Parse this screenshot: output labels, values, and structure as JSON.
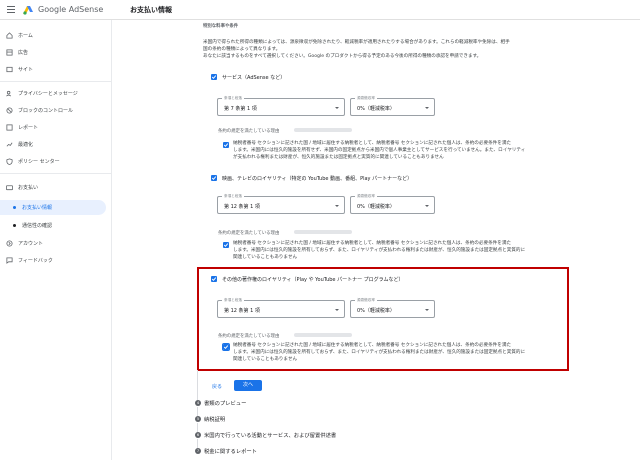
{
  "topbar": {
    "brand": "Google AdSense",
    "title": "お支払い情報"
  },
  "sidebar": {
    "items": [
      {
        "label": "ホーム",
        "icon": "home-icon"
      },
      {
        "label": "広告",
        "icon": "ads-icon"
      },
      {
        "label": "サイト",
        "icon": "sites-icon"
      },
      {
        "label": "プライバシーとメッセージ",
        "icon": "privacy-icon"
      },
      {
        "label": "ブロックのコントロール",
        "icon": "block-icon"
      },
      {
        "label": "レポート",
        "icon": "reports-icon"
      },
      {
        "label": "最適化",
        "icon": "optimize-icon"
      },
      {
        "label": "ポリシー センター",
        "icon": "policy-icon"
      },
      {
        "label": "お支払い",
        "icon": "payments-icon"
      },
      {
        "label": "お支払い情報",
        "icon": "dot"
      },
      {
        "label": "通信性の確認",
        "icon": "dot"
      },
      {
        "label": "アカウント",
        "icon": "account-icon"
      },
      {
        "label": "フィードバック",
        "icon": "feedback-icon"
      }
    ]
  },
  "form": {
    "section_title": "特別な料率や条件",
    "intro_line1": "米国内で得られた所得の種類によっては、源泉徴収が免除されたり、軽減税率が適用されたりする場合があります。これらの軽減税率や免除は、相手",
    "intro_line2": "国の条約の種類によって異なります。",
    "intro_line3": "あなたに該当するものをすべて選択してください。Google のプロダクトから得る予定のある今後の所得の種類の承認を申請できます。",
    "service_label": "サービス（AdSense など）",
    "treaty_label": "条項と段落",
    "rate_label": "源泉徴収率",
    "service_treaty": "第 7 条第 1 項",
    "service_rate": "0%（軽減税率）",
    "reason_label": "条約の規定を満たしている理由",
    "service_reason1": "納税者番号 セクションに記された国 / 地域に居住する納税者として、納税者番号 セクションに記された個人は、条約の必要条件を満た",
    "service_reason2": "します。米国内には恒久的施設を所有せず、米国内の固定拠点から米国内で個人事業主としてサービスを行っていません。また、ロイヤリティ",
    "service_reason3": "が支払われる権利または財産が、恒久的施設または固定拠点と実質的に関連していることもありません",
    "film_label": "映画、テレビのロイヤリティ（特定の YouTube 動画、番組、Play パートナーなど）",
    "film_treaty": "第 12 条第 1 項",
    "film_rate": "0%（軽減税率）",
    "royalty_reason1": "納税者番号 セクションに記された国 / 地域に居住する納税者として、納税者番号 セクションに記された個人は、条約の必要条件を満た",
    "royalty_reason2": "します。米国内には恒久的施設を所有しておらず、また、ロイヤリティが支払われる権利または財産が、恒久的施設または固定拠点と実質的に",
    "royalty_reason3": "関連していることもありません",
    "copyright_label": "その他の著作権のロイヤリティ（Play や YouTube パートナー プログラムなど）",
    "copyright_treaty": "第 12 条第 1 項",
    "copyright_rate": "0%（軽減税率）",
    "back_label": "戻る",
    "next_label": "次へ"
  },
  "steps": [
    {
      "num": "4",
      "label": "書類のプレビュー"
    },
    {
      "num": "5",
      "label": "納税証明"
    },
    {
      "num": "6",
      "label": "米国内で行っている活動とサービス、および留置供述書"
    },
    {
      "num": "7",
      "label": "税金に関するレポート"
    }
  ],
  "colors": {
    "accent": "#1a73e8",
    "highlight": "#c00000"
  }
}
